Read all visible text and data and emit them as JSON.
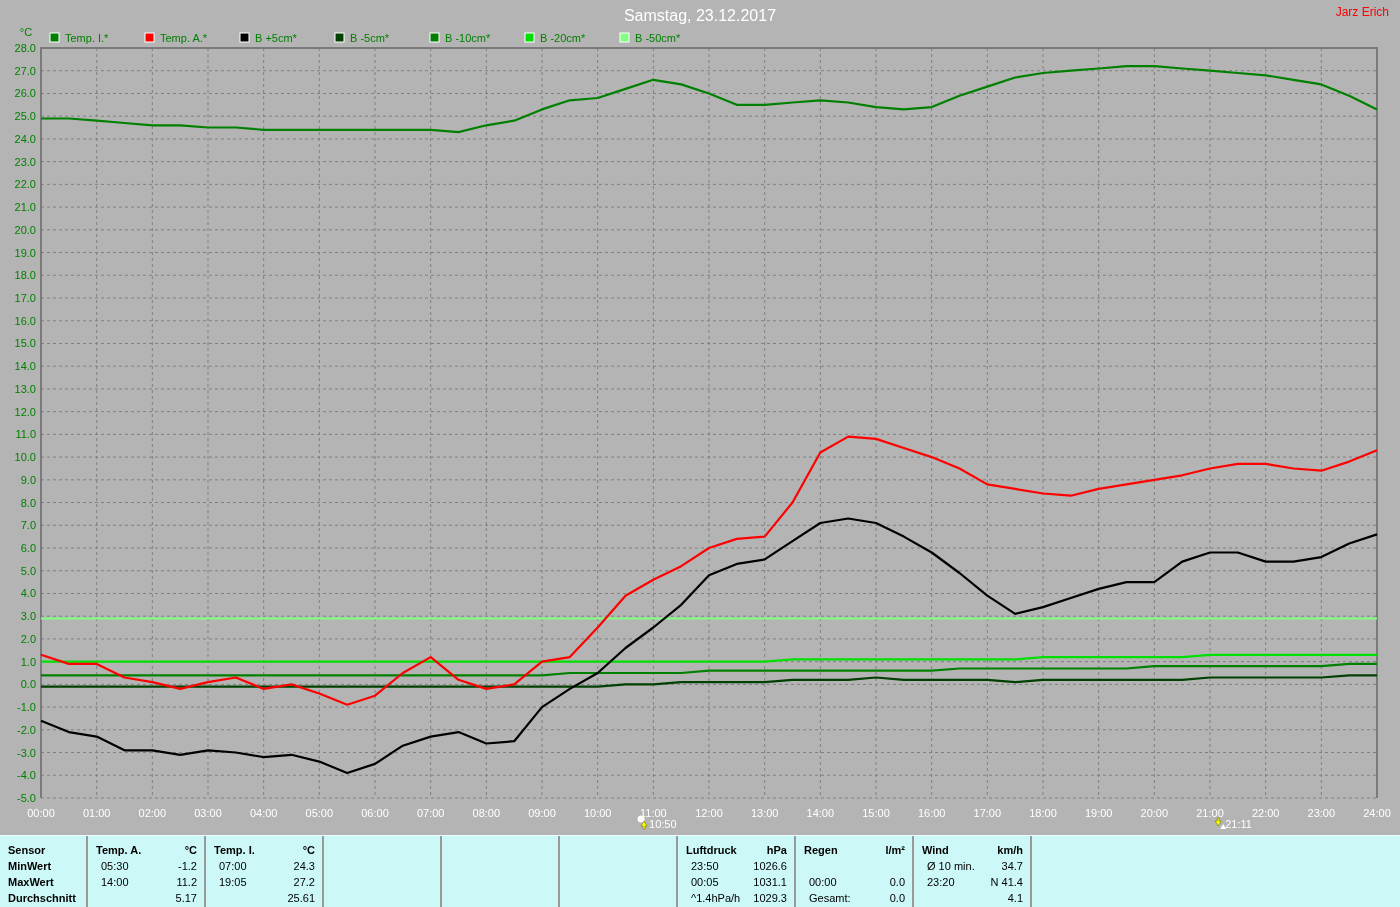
{
  "window": {
    "title": "Samstag, 23.12.2017",
    "author": "Jarz Erich"
  },
  "chart": {
    "chart_data": {
      "type": "line",
      "ylabel": "°C",
      "xlim": [
        0,
        24
      ],
      "ylim": [
        -5,
        28
      ],
      "x": [
        0,
        0.5,
        1,
        1.5,
        2,
        2.5,
        3,
        3.5,
        4,
        4.5,
        5,
        5.5,
        6,
        6.5,
        7,
        7.5,
        8,
        8.5,
        9,
        9.5,
        10,
        10.5,
        11,
        11.5,
        12,
        12.5,
        13,
        13.5,
        14,
        14.5,
        15,
        15.5,
        16,
        16.5,
        17,
        17.5,
        18,
        18.5,
        19,
        19.5,
        20,
        20.5,
        21,
        21.5,
        22,
        22.5,
        23,
        23.5,
        24
      ],
      "xticks": [
        {
          "value": 0,
          "label": "00:00"
        },
        {
          "value": 1,
          "label": "01:00"
        },
        {
          "value": 2,
          "label": "02:00"
        },
        {
          "value": 3,
          "label": "03:00"
        },
        {
          "value": 4,
          "label": "04:00"
        },
        {
          "value": 5,
          "label": "05:00"
        },
        {
          "value": 6,
          "label": "06:00"
        },
        {
          "value": 7,
          "label": "07:00"
        },
        {
          "value": 8,
          "label": "08:00"
        },
        {
          "value": 9,
          "label": "09:00"
        },
        {
          "value": 10,
          "label": "10:00"
        },
        {
          "value": 11,
          "label": "11:00"
        },
        {
          "value": 12,
          "label": "12:00"
        },
        {
          "value": 13,
          "label": "13:00"
        },
        {
          "value": 14,
          "label": "14:00"
        },
        {
          "value": 15,
          "label": "15:00"
        },
        {
          "value": 16,
          "label": "16:00"
        },
        {
          "value": 17,
          "label": "17:00"
        },
        {
          "value": 18,
          "label": "18:00"
        },
        {
          "value": 19,
          "label": "19:00"
        },
        {
          "value": 20,
          "label": "20:00"
        },
        {
          "value": 21,
          "label": "21:00"
        },
        {
          "value": 22,
          "label": "22:00"
        },
        {
          "value": 23,
          "label": "23:00"
        },
        {
          "value": 24,
          "label": "24:00"
        }
      ],
      "yticks": [
        {
          "value": -5,
          "label": "-5.0"
        },
        {
          "value": -4,
          "label": "-4.0"
        },
        {
          "value": -3,
          "label": "-3.0"
        },
        {
          "value": -2,
          "label": "-2.0"
        },
        {
          "value": -1,
          "label": "-1.0"
        },
        {
          "value": 0,
          "label": "0.0"
        },
        {
          "value": 1,
          "label": "1.0"
        },
        {
          "value": 2,
          "label": "2.0"
        },
        {
          "value": 3,
          "label": "3.0"
        },
        {
          "value": 4,
          "label": "4.0"
        },
        {
          "value": 5,
          "label": "5.0"
        },
        {
          "value": 6,
          "label": "6.0"
        },
        {
          "value": 7,
          "label": "7.0"
        },
        {
          "value": 8,
          "label": "8.0"
        },
        {
          "value": 9,
          "label": "9.0"
        },
        {
          "value": 10,
          "label": "10.0"
        },
        {
          "value": 11,
          "label": "11.0"
        },
        {
          "value": 12,
          "label": "12.0"
        },
        {
          "value": 13,
          "label": "13.0"
        },
        {
          "value": 14,
          "label": "14.0"
        },
        {
          "value": 15,
          "label": "15.0"
        },
        {
          "value": 16,
          "label": "16.0"
        },
        {
          "value": 17,
          "label": "17.0"
        },
        {
          "value": 18,
          "label": "18.0"
        },
        {
          "value": 19,
          "label": "19.0"
        },
        {
          "value": 20,
          "label": "20.0"
        },
        {
          "value": 21,
          "label": "21.0"
        },
        {
          "value": 22,
          "label": "22.0"
        },
        {
          "value": 23,
          "label": "23.0"
        },
        {
          "value": 24,
          "label": "24.0"
        },
        {
          "value": 25,
          "label": "25.0"
        },
        {
          "value": 26,
          "label": "26.0"
        },
        {
          "value": 27,
          "label": "27.0"
        },
        {
          "value": 28,
          "label": "28.0"
        }
      ],
      "series": [
        {
          "name": "Temp. I.*",
          "color": "#008000",
          "values": [
            24.9,
            24.9,
            24.8,
            24.7,
            24.6,
            24.6,
            24.5,
            24.5,
            24.4,
            24.4,
            24.4,
            24.4,
            24.4,
            24.4,
            24.4,
            24.3,
            24.6,
            24.8,
            25.3,
            25.7,
            25.8,
            26.2,
            26.6,
            26.4,
            26.0,
            25.5,
            25.5,
            25.6,
            25.7,
            25.6,
            25.4,
            25.3,
            25.4,
            25.9,
            26.3,
            26.7,
            26.9,
            27.0,
            27.1,
            27.2,
            27.2,
            27.1,
            27.0,
            26.9,
            26.8,
            26.6,
            26.4,
            25.9,
            25.3
          ]
        },
        {
          "name": "Temp. A.*",
          "color": "#ff0000",
          "values": [
            1.3,
            0.9,
            0.9,
            0.3,
            0.1,
            -0.2,
            0.1,
            0.3,
            -0.2,
            0.0,
            -0.4,
            -0.9,
            -0.5,
            0.5,
            1.2,
            0.2,
            -0.2,
            0.0,
            1.0,
            1.2,
            2.5,
            3.9,
            4.6,
            5.2,
            6.0,
            6.4,
            6.5,
            8.0,
            10.2,
            10.9,
            10.8,
            10.4,
            10.0,
            9.5,
            8.8,
            8.6,
            8.4,
            8.3,
            8.6,
            8.8,
            9.0,
            9.2,
            9.5,
            9.7,
            9.7,
            9.5,
            9.4,
            9.8,
            10.3
          ]
        },
        {
          "name": "B +5cm*",
          "color": "#000000",
          "values": [
            -1.6,
            -2.1,
            -2.3,
            -2.9,
            -2.9,
            -3.1,
            -2.9,
            -3.0,
            -3.2,
            -3.1,
            -3.4,
            -3.9,
            -3.5,
            -2.7,
            -2.3,
            -2.1,
            -2.6,
            -2.5,
            -1.0,
            -0.2,
            0.5,
            1.6,
            2.5,
            3.5,
            4.8,
            5.3,
            5.5,
            6.3,
            7.1,
            7.3,
            7.1,
            6.5,
            5.8,
            4.9,
            3.9,
            3.1,
            3.4,
            3.8,
            4.2,
            4.5,
            4.5,
            5.4,
            5.8,
            5.8,
            5.4,
            5.4,
            5.6,
            6.2,
            6.6
          ]
        },
        {
          "name": "B -5cm*",
          "color": "#004000",
          "values": [
            -0.1,
            -0.1,
            -0.1,
            -0.1,
            -0.1,
            -0.1,
            -0.1,
            -0.1,
            -0.1,
            -0.1,
            -0.1,
            -0.1,
            -0.1,
            -0.1,
            -0.1,
            -0.1,
            -0.1,
            -0.1,
            -0.1,
            -0.1,
            -0.1,
            0.0,
            0.0,
            0.1,
            0.1,
            0.1,
            0.1,
            0.2,
            0.2,
            0.2,
            0.3,
            0.2,
            0.2,
            0.2,
            0.2,
            0.1,
            0.2,
            0.2,
            0.2,
            0.2,
            0.2,
            0.2,
            0.3,
            0.3,
            0.3,
            0.3,
            0.3,
            0.4,
            0.4
          ]
        },
        {
          "name": "B -10cm*",
          "color": "#008000",
          "values": [
            0.4,
            0.4,
            0.4,
            0.4,
            0.4,
            0.4,
            0.4,
            0.4,
            0.4,
            0.4,
            0.4,
            0.4,
            0.4,
            0.4,
            0.4,
            0.4,
            0.4,
            0.4,
            0.4,
            0.5,
            0.5,
            0.5,
            0.5,
            0.5,
            0.6,
            0.6,
            0.6,
            0.6,
            0.6,
            0.6,
            0.6,
            0.6,
            0.6,
            0.7,
            0.7,
            0.7,
            0.7,
            0.7,
            0.7,
            0.7,
            0.8,
            0.8,
            0.8,
            0.8,
            0.8,
            0.8,
            0.8,
            0.9,
            0.9
          ]
        },
        {
          "name": "B -20cm*",
          "color": "#00e000",
          "values": [
            1.0,
            1.0,
            1.0,
            1.0,
            1.0,
            1.0,
            1.0,
            1.0,
            1.0,
            1.0,
            1.0,
            1.0,
            1.0,
            1.0,
            1.0,
            1.0,
            1.0,
            1.0,
            1.0,
            1.0,
            1.0,
            1.0,
            1.0,
            1.0,
            1.0,
            1.0,
            1.0,
            1.1,
            1.1,
            1.1,
            1.1,
            1.1,
            1.1,
            1.1,
            1.1,
            1.1,
            1.2,
            1.2,
            1.2,
            1.2,
            1.2,
            1.2,
            1.3,
            1.3,
            1.3,
            1.3,
            1.3,
            1.3,
            1.3
          ]
        },
        {
          "name": "B -50cm*",
          "color": "#80ff80",
          "values": [
            2.9,
            2.9,
            2.9,
            2.9,
            2.9,
            2.9,
            2.9,
            2.9,
            2.9,
            2.9,
            2.9,
            2.9,
            2.9,
            2.9,
            2.9,
            2.9,
            2.9,
            2.9,
            2.9,
            2.9,
            2.9,
            2.9,
            2.9,
            2.9,
            2.9,
            2.9,
            2.9,
            2.9,
            2.9,
            2.9,
            2.9,
            2.9,
            2.9,
            2.9,
            2.9,
            2.9,
            2.9,
            2.9,
            2.9,
            2.9,
            2.9,
            2.9,
            2.9,
            2.9,
            2.9,
            2.9,
            2.9,
            2.9,
            2.9
          ]
        }
      ],
      "grid": true,
      "legend": true
    },
    "markers": [
      {
        "kind": "rise",
        "time": "10:50"
      },
      {
        "kind": "set",
        "time": "21:11"
      }
    ]
  },
  "summary": {
    "row_labels": [
      "Sensor",
      "MinWert",
      "MaxWert",
      "Durchschnitt"
    ],
    "panels": [
      {
        "kind": "data",
        "name": "Temp. A.",
        "unit": "°C",
        "rows": [
          {
            "label": "05:30",
            "value": "-1.2"
          },
          {
            "label": "14:00",
            "value": "11.2"
          },
          {
            "value": "5.17"
          }
        ]
      },
      {
        "kind": "data",
        "name": "Temp. I.",
        "unit": "°C",
        "rows": [
          {
            "label": "07:00",
            "value": "24.3"
          },
          {
            "label": "19:05",
            "value": "27.2"
          },
          {
            "value": "25.61"
          }
        ]
      },
      {
        "kind": "empty"
      },
      {
        "kind": "empty"
      },
      {
        "kind": "empty"
      },
      {
        "kind": "data",
        "name": "Luftdruck",
        "unit": "hPa",
        "rows": [
          {
            "label": "23:50",
            "value": "1026.6"
          },
          {
            "label": "00:05",
            "value": "1031.1"
          },
          {
            "label": "^1.4hPa/h",
            "value": "1029.3"
          }
        ]
      },
      {
        "kind": "data",
        "name": "Regen",
        "unit": "l/m²",
        "rows": [
          null,
          {
            "label": "00:00",
            "value": "0.0"
          },
          {
            "label": "Gesamt:",
            "value": "0.0"
          }
        ]
      },
      {
        "kind": "data",
        "name": "Wind",
        "unit": "km/h",
        "rows": [
          {
            "label": "Ø 10 min.",
            "value": "34.7"
          },
          {
            "label": "23:20",
            "value": "N 41.4"
          },
          {
            "value": "4.1"
          }
        ]
      }
    ]
  }
}
